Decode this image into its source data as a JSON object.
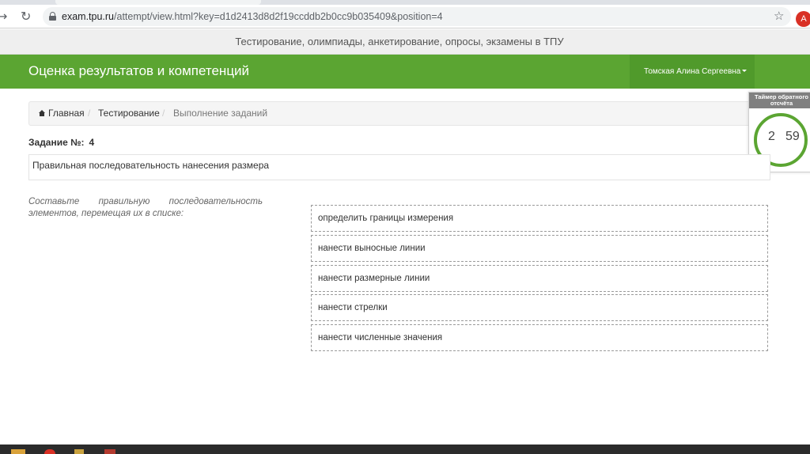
{
  "browser": {
    "back_icon": "→",
    "reload_icon": "↻",
    "url_host": "exam.tpu.ru",
    "url_path": "/attempt/view.html?key=d1d2413d8d2f19ccddb2b0cc9b035409&position=4",
    "star_icon": "☆",
    "profile_initial": "A"
  },
  "banner": {
    "text": "Тестирование, олимпиады, анкетирование, опросы, экзамены в ТПУ"
  },
  "navbar": {
    "brand": "Оценка результатов и компетенций",
    "user_name": "Томская Алина Сергеевна"
  },
  "breadcrumb": {
    "home": "Главная",
    "testing": "Тестирование",
    "current": "Выполнение заданий",
    "separator": "/"
  },
  "timer": {
    "title": "Таймер обратного отсчёта",
    "minutes": "2",
    "seconds": "59"
  },
  "task": {
    "label": "Задание №:",
    "number": "4",
    "question": "Правильная последовательность нанесения размера",
    "instruction": "Составьте правильную последовательность элементов, перемещая их в списке:",
    "items": [
      "определить границы измерения",
      "нанести выносные линии",
      "нанести размерные линии",
      "нанести стрелки",
      "нанести численные значения"
    ]
  },
  "colors": {
    "navbar": "#5ba532",
    "timer_ring": "#5ba532",
    "timer_header": "#808080",
    "profile_avatar": "#d93025"
  }
}
